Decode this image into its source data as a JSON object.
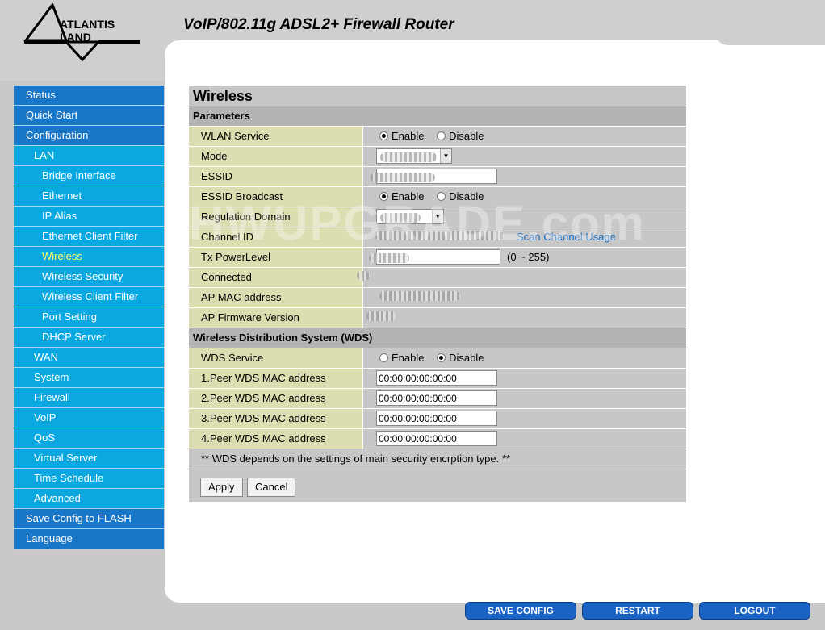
{
  "header": {
    "logo_text": "ATLANTIS LAND",
    "title": "VoIP/802.11g ADSL2+ Firewall Router"
  },
  "sidebar": {
    "items": [
      {
        "label": "Status"
      },
      {
        "label": "Quick Start"
      },
      {
        "label": "Configuration"
      },
      {
        "label": "LAN"
      },
      {
        "label": "Bridge Interface"
      },
      {
        "label": "Ethernet"
      },
      {
        "label": "IP Alias"
      },
      {
        "label": "Ethernet Client Filter"
      },
      {
        "label": "Wireless"
      },
      {
        "label": "Wireless Security"
      },
      {
        "label": "Wireless Client Filter"
      },
      {
        "label": "Port Setting"
      },
      {
        "label": "DHCP Server"
      },
      {
        "label": "WAN"
      },
      {
        "label": "System"
      },
      {
        "label": "Firewall"
      },
      {
        "label": "VoIP"
      },
      {
        "label": "QoS"
      },
      {
        "label": "Virtual Server"
      },
      {
        "label": "Time Schedule"
      },
      {
        "label": "Advanced"
      },
      {
        "label": "Save Config to FLASH"
      },
      {
        "label": "Language"
      }
    ]
  },
  "form": {
    "title": "Wireless",
    "params_header": "Parameters",
    "wlan_service": {
      "label": "WLAN Service",
      "options": [
        "Enable",
        "Disable"
      ],
      "selected": "Enable"
    },
    "mode": {
      "label": "Mode"
    },
    "essid": {
      "label": "ESSID"
    },
    "essid_broadcast": {
      "label": "ESSID Broadcast",
      "options": [
        "Enable",
        "Disable"
      ],
      "selected": "Enable"
    },
    "regulation_domain": {
      "label": "Regulation Domain"
    },
    "channel_id": {
      "label": "Channel ID",
      "link": "Scan Channel Usage"
    },
    "tx_power": {
      "label": "Tx PowerLevel",
      "hint": "(0 ~ 255)"
    },
    "connected": {
      "label": "Connected"
    },
    "ap_mac": {
      "label": "AP MAC address"
    },
    "ap_fw": {
      "label": "AP Firmware Version"
    },
    "wds_header": "Wireless Distribution System (WDS)",
    "wds_service": {
      "label": "WDS Service",
      "options": [
        "Enable",
        "Disable"
      ],
      "selected": "Disable"
    },
    "peers": [
      {
        "label": "1.Peer WDS MAC address",
        "value": "00:00:00:00:00:00"
      },
      {
        "label": "2.Peer WDS MAC address",
        "value": "00:00:00:00:00:00"
      },
      {
        "label": "3.Peer WDS MAC address",
        "value": "00:00:00:00:00:00"
      },
      {
        "label": "4.Peer WDS MAC address",
        "value": "00:00:00:00:00:00"
      }
    ],
    "note": "** WDS depends on the settings of main security encrption type. **",
    "apply_label": "Apply",
    "cancel_label": "Cancel"
  },
  "watermark": "HWUPGRADE.com",
  "bottom": {
    "save": "SAVE CONFIG",
    "restart": "RESTART",
    "logout": "LOGOUT"
  }
}
